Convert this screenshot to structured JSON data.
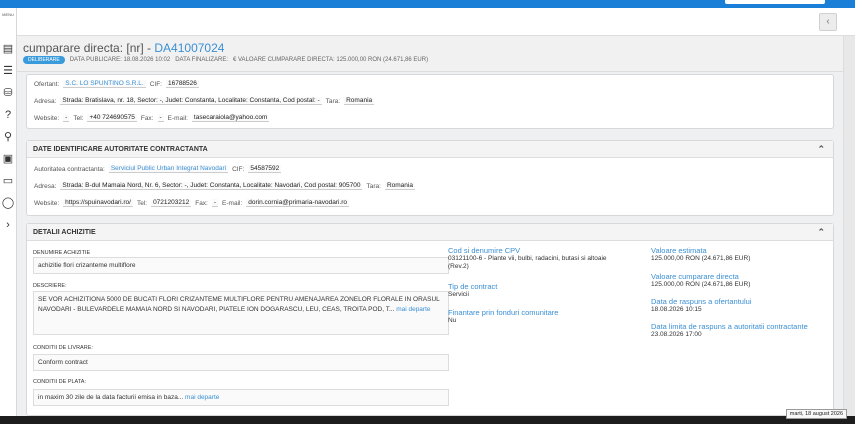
{
  "app": {
    "menu_label": "MENU",
    "back_icon": "‹",
    "sidebar_icons": [
      "document-icon",
      "list-icon",
      "database-icon",
      "help-icon",
      "rocket-icon",
      "id-card-icon",
      "monitor-icon",
      "chat-icon",
      "chevron-right-icon"
    ]
  },
  "procedure": {
    "title_prefix": "cumparare directa: [nr] - ",
    "code": "DA41007024",
    "status_badge": "DELIBERARE",
    "publish_label": "DATA PUBLICARE: 18.08.2026 10:02",
    "finalize_label": "DATA FINALIZARE:",
    "value_label": "€ VALOARE CUMPARARE DIRECTA: 125.000,00  RON (24.671,86  EUR)"
  },
  "offerer": {
    "ofertant_label": "Ofertant:",
    "ofertant_value": "S.C. LO SPUNTINO S.R.L.",
    "cif_label": "CIF:",
    "cif_value": "16788526",
    "address_label": "Adresa:",
    "address_value": "Strada: Bratislava, nr. 18, Sector: -, Judet: Constanta, Localitate: Constanta, Cod postal: -",
    "country_label": "Tara:",
    "country_value": "Romania",
    "website_label": "Website:",
    "website_value": "-",
    "tel_label": "Tel:",
    "tel_value": "+40 724690575",
    "fax_label": "Fax:",
    "fax_value": "-",
    "email_label": "E-mail:",
    "email_value": "tasecaraiola@yahoo.com"
  },
  "authority": {
    "header": "DATE IDENTIFICARE AUTORITATE CONTRACTANTA",
    "name_label": "Autoritatea contractanta:",
    "name_value": "Serviciul Public Urban Integrat Navodari",
    "cif_label": "CIF:",
    "cif_value": "54587592",
    "address_label": "Adresa:",
    "address_value": "Strada: B-dul Mamaia Nord, Nr. 6, Sector: -, Judet: Constanta, Localitate: Navodari, Cod postal: 905700",
    "country_label": "Tara:",
    "country_value": "Romania",
    "website_label": "Website:",
    "website_value": "https://spuinavodari.ro/",
    "tel_label": "Tel:",
    "tel_value": "0721203212",
    "fax_label": "Fax:",
    "fax_value": "-",
    "email_label": "E-mail:",
    "email_value": "dorin.cornia@primaria-navodari.ro"
  },
  "details": {
    "header": "DETALII ACHIZITIE",
    "name_label": "DENUMIRE ACHIZITIE",
    "name_value": "achizitie flori crizanteme multiflore",
    "desc_label": "DESCRIERE:",
    "desc_value": "SE VOR ACHIZITIONA 5000 DE BUCATI FLORI CRIZANTEME MULTIFLORE PENTRU AMENAJAREA ZONELOR FLORALE IN ORASUL NAVODARI - BULEVARDELE MAMAIA NORD SI NAVODARI, PIATELE ION DOGARASCU, LEU, CEAS, TROITA POD, T...",
    "more_label": "mai departe",
    "delivery_label": "CONDITII DE LIVRARE:",
    "delivery_value": "Conform contract",
    "payment_label": "CONDITII DE PLATA:",
    "payment_value": "in maxim 30 zile de la data facturii emisa in baza...",
    "cpv_title": "Cod si denumire CPV",
    "cpv_value": "03121100-6 - Plante vii, bulbi, radacini, butasi si altoaie (Rev.2)",
    "contract_type_title": "Tip de contract",
    "contract_type_value": "Servicii",
    "funding_title": "Finantare prin fonduri comunitare",
    "funding_value": "Nu",
    "est_value_title": "Valoare estimata",
    "est_value_value": "125.000,00  RON (24.671,86  EUR)",
    "direct_value_title": "Valoare cumparare directa",
    "direct_value_value": "125.000,00  RON (24.671,86  EUR)",
    "response_date_title": "Data de raspuns a ofertantului",
    "response_date_value": "18.08.2026 10:15",
    "deadline_title": "Data limita de raspuns a autoritatii contractante",
    "deadline_value": "23.08.2026 17:00"
  },
  "system": {
    "date_tooltip": "marti, 18 august 2026"
  },
  "colors": {
    "topbar": "#1a7fd6",
    "link": "#3a8fd4",
    "badge": "#3a9bdc"
  }
}
